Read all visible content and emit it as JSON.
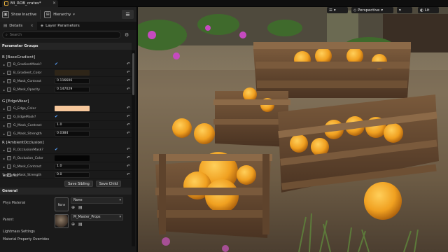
{
  "window": {
    "tab_title": "MI_ROB_crates*"
  },
  "toolbar": {
    "show_inactive": "Show Inactive",
    "hierarchy": "Hierarchy"
  },
  "panel_tabs": {
    "details": "Details",
    "layer_parameters": "Layer Parameters"
  },
  "search": {
    "placeholder": "Search"
  },
  "parameter_groups": {
    "header": "Parameter Groups",
    "groups": [
      {
        "label": "B [BaseGradient]",
        "rows": [
          {
            "label": "B_GradientMask?",
            "kind": "bool"
          },
          {
            "label": "B_Gradient_Color",
            "kind": "color",
            "color": "#2e2518"
          },
          {
            "label": "B_Mask_Contrast",
            "kind": "value",
            "value": "0.116606"
          },
          {
            "label": "B_Mask_Opacity",
            "kind": "value",
            "value": "0.147029"
          }
        ]
      },
      {
        "label": "G [EdgeWear]",
        "rows": [
          {
            "label": "G_Edge_Color",
            "kind": "color",
            "color": "#f6c79b"
          },
          {
            "label": "G_EdgeMask?",
            "kind": "bool"
          },
          {
            "label": "G_Mask_Contrast",
            "kind": "value",
            "value": "1.0"
          },
          {
            "label": "G_Mask_Strength",
            "kind": "value",
            "value": "0.0384"
          }
        ]
      },
      {
        "label": "R [AmbientOcclusion]",
        "rows": [
          {
            "label": "R_OcclusionMask?",
            "kind": "bool"
          },
          {
            "label": "R_Occlusion_Color",
            "kind": "color",
            "color": "#050505"
          },
          {
            "label": "R_Mask_Contrast",
            "kind": "value",
            "value": "1.0"
          },
          {
            "label": "R_Mask_Strength",
            "kind": "value",
            "value": "0.0"
          }
        ]
      }
    ],
    "textures_label": "Textures",
    "save_sibling": "Save Sibling",
    "save_child": "Save Child"
  },
  "general": {
    "header": "General",
    "phys_material_label": "Phys Material",
    "phys_thumb_label": "None",
    "phys_value": "None",
    "parent_label": "Parent",
    "parent_value": "M_Master_Props",
    "lightmass": "Lightmass Settings",
    "overrides": "Material Property Overrides"
  },
  "viewport": {
    "perspective": "Perspective",
    "lit": "Lit"
  },
  "icons": [
    "material-icon",
    "close-icon",
    "show-inactive-icon",
    "hierarchy-icon",
    "menu-icon",
    "details-icon",
    "layers-icon",
    "search-icon",
    "gear-icon",
    "reset-icon",
    "checkbox-icon",
    "expand-arrow-icon",
    "browse-icon",
    "find-icon",
    "chevron-down-icon",
    "viewport-menu-icon",
    "camera-icon",
    "lit-icon"
  ]
}
